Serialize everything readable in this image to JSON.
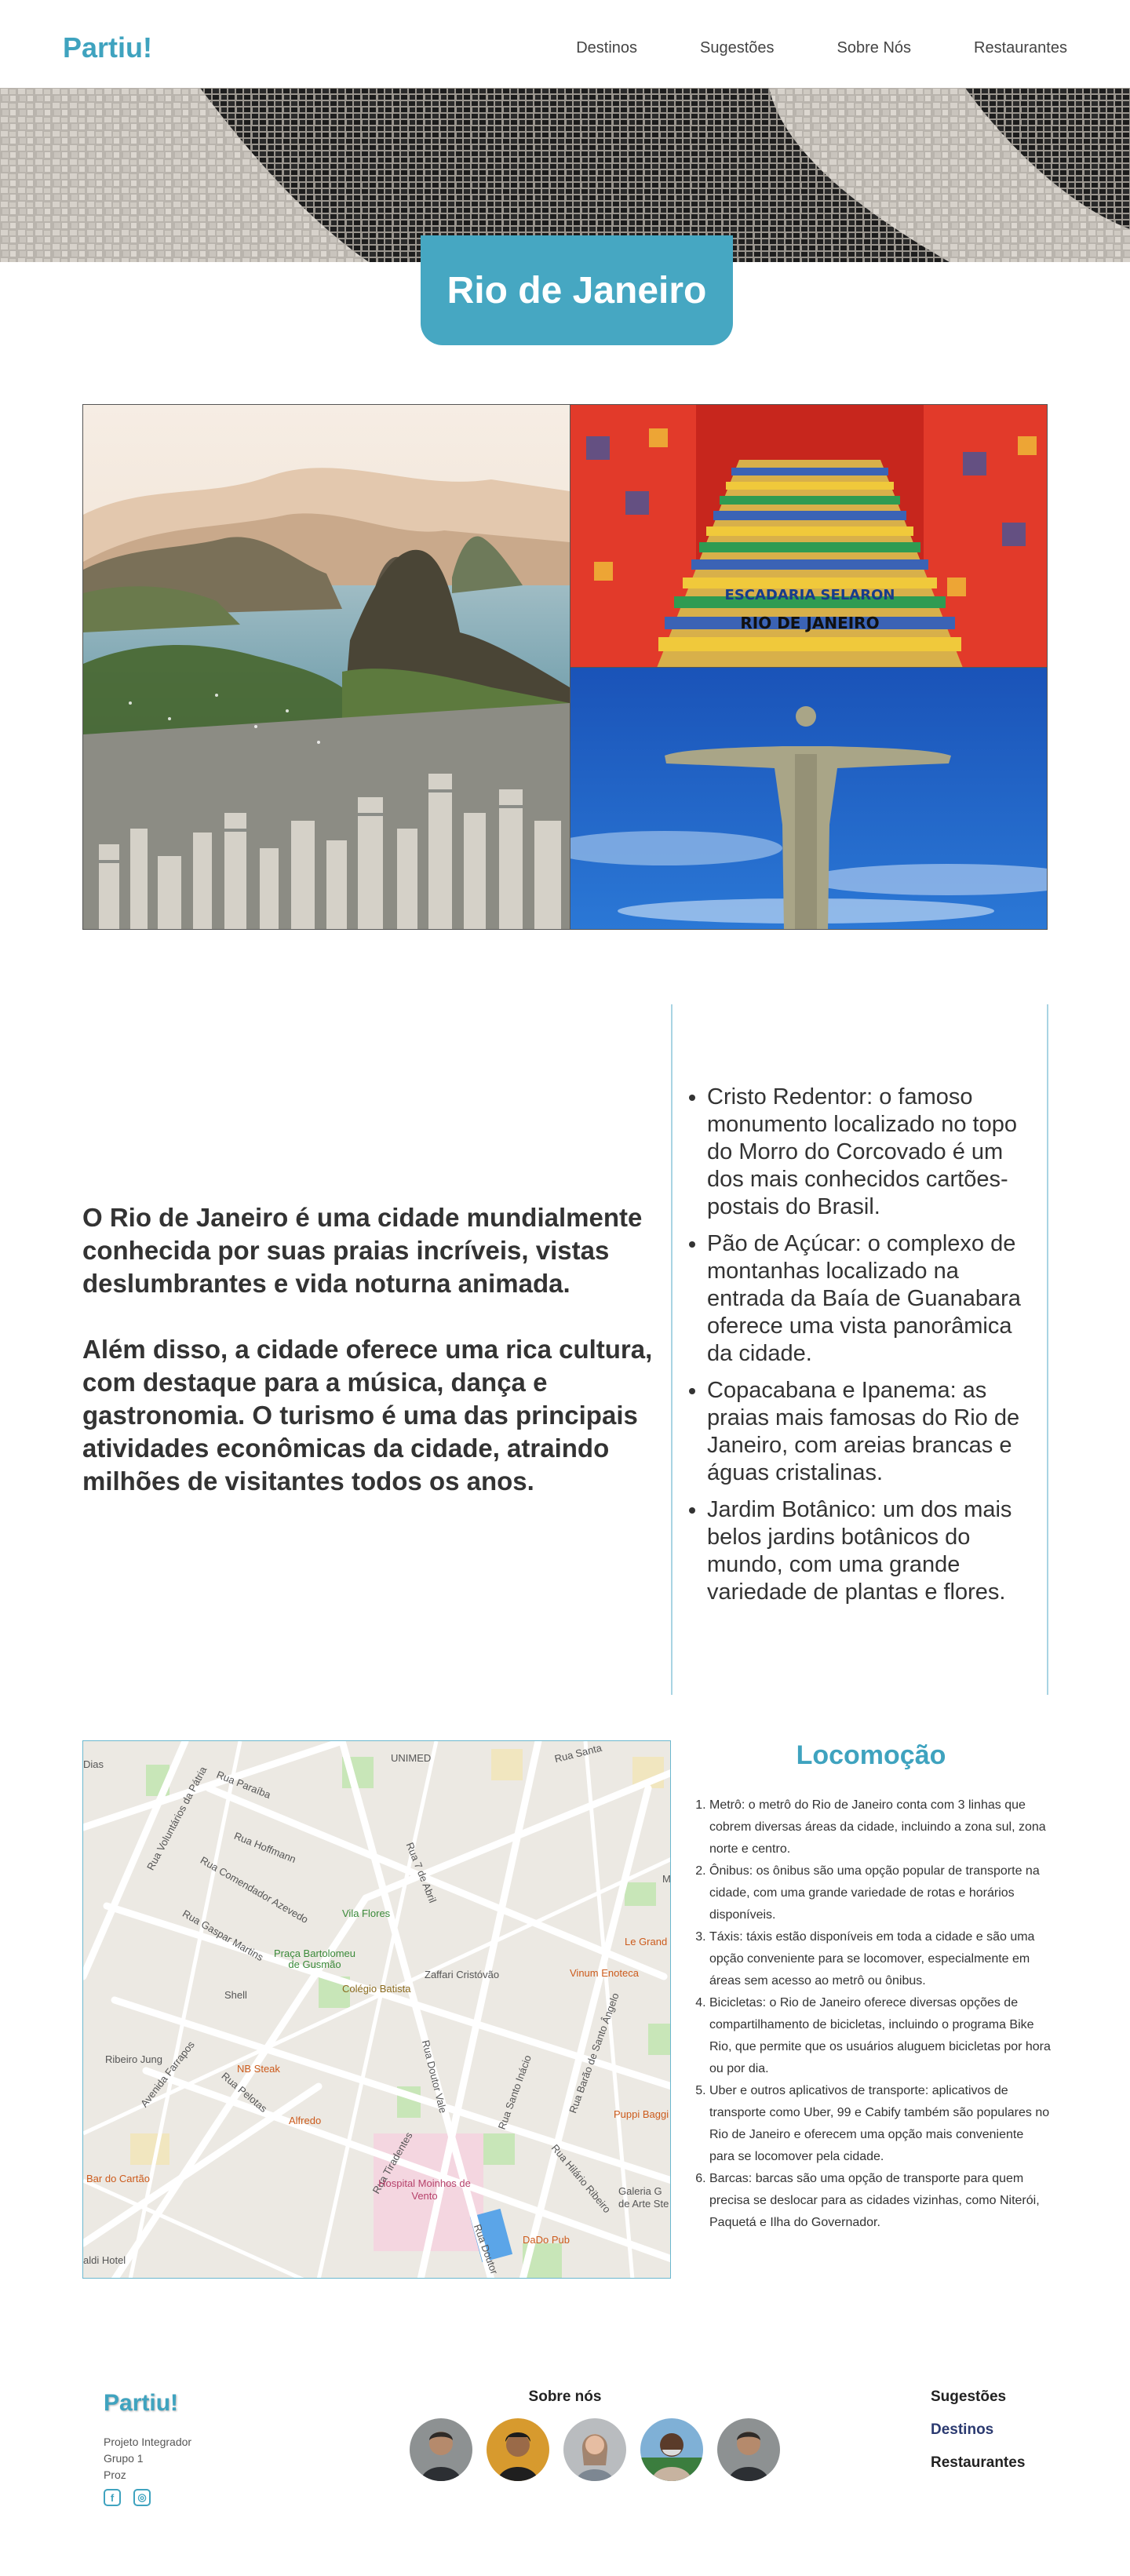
{
  "nav": {
    "logo": "Partiu!",
    "links": [
      "Destinos",
      "Sugestões",
      "Sobre Nós",
      "Restaurantes"
    ]
  },
  "hero": {
    "title": "Rio de Janeiro"
  },
  "gallery": {
    "sign_top": "ESCADARIA SELARON",
    "sign_bottom": "RIO DE JANEIRO"
  },
  "intro": {
    "paragraphs": [
      "O Rio de Janeiro é uma cidade mundialmente conhecida por suas praias incríveis, vistas deslumbrantes e vida noturna animada.",
      "Além disso, a cidade oferece uma rica cultura, com destaque para a música, dança e gastronomia. O turismo é uma das principais atividades econômicas da cidade, atraindo milhões de visitantes todos os anos."
    ]
  },
  "attractions": [
    "Cristo Redentor: o famoso monumento localizado no topo do Morro do Corcovado é um dos mais conhecidos cartões-postais do Brasil.",
    "Pão de Açúcar: o complexo de montanhas localizado na entrada da Baía de Guanabara oferece uma vista panorâmica da cidade.",
    "Copacabana e Ipanema: as praias mais famosas do Rio de Janeiro, com areias brancas e águas cristalinas.",
    "Jardim Botânico: um dos mais belos jardins botânicos do mundo, com uma grande variedade de plantas e flores."
  ],
  "map": {
    "streets": [
      "Rua Voluntários da Pátria",
      "Rua Paraíba",
      "Rua Hoffmann",
      "Rua Comendador Azevedo",
      "Rua Gaspar Martins",
      "Rua 7 de Abril",
      "Avenida Farrapos",
      "Rua Pelotas",
      "Rua Doutor Vale",
      "Rua Tiradentes",
      "Rua Santo Inácio",
      "Rua Barão de Santo Ângelo",
      "Rua Hilário Ribeiro",
      "Rua Santa",
      "Rua Doutor"
    ],
    "places": [
      "UNIMED",
      "Vila Flores",
      "Praça Bartolomeu de Gusmão",
      "Colégio Batista",
      "Zaffari Cristóvão",
      "Shell",
      "NB Steak",
      "Ribeiro Jung",
      "Alfredo",
      "Bar do Cartão",
      "Hospital Moinhos de Vento",
      "DaDo Pub",
      "Vinum Enoteca",
      "Le Grand",
      "Puppi Baggi",
      "Galeria G de Arte Ste",
      "Dias",
      "aldi Hotel",
      "M"
    ]
  },
  "locomocao": {
    "title": "Locomoção",
    "items": [
      "Metrô: o metrô do Rio de Janeiro conta com 3 linhas que cobrem diversas áreas da cidade, incluindo a zona sul, zona norte e centro.",
      "Ônibus: os ônibus são uma opção popular de transporte na cidade, com uma grande variedade de rotas e horários disponíveis.",
      "Táxis: táxis estão disponíveis em toda a cidade e são uma opção conveniente para se locomover, especialmente em áreas sem acesso ao metrô ou ônibus.",
      "Bicicletas: o Rio de Janeiro oferece diversas opções de compartilhamento de bicicletas, incluindo o programa Bike Rio, que permite que os usuários aluguem bicicletas por hora ou por dia.",
      "Uber e outros aplicativos de transporte: aplicativos de transporte como Uber, 99 e Cabify também são populares no Rio de Janeiro e oferecem uma opção mais conveniente para se locomover pela cidade.",
      "Barcas: barcas são uma opção de transporte para quem precisa se deslocar para as cidades vizinhas, como Niterói, Paquetá e Ilha do Governador."
    ]
  },
  "footer": {
    "logo": "Partiu!",
    "info": [
      "Projeto Integrador",
      "Grupo 1",
      "Proz"
    ],
    "social_icons": [
      "facebook-icon",
      "instagram-icon"
    ],
    "about_title": "Sobre nós",
    "avatars": 5,
    "links": [
      "Sugestões",
      "Destinos",
      "Restaurantes"
    ]
  }
}
